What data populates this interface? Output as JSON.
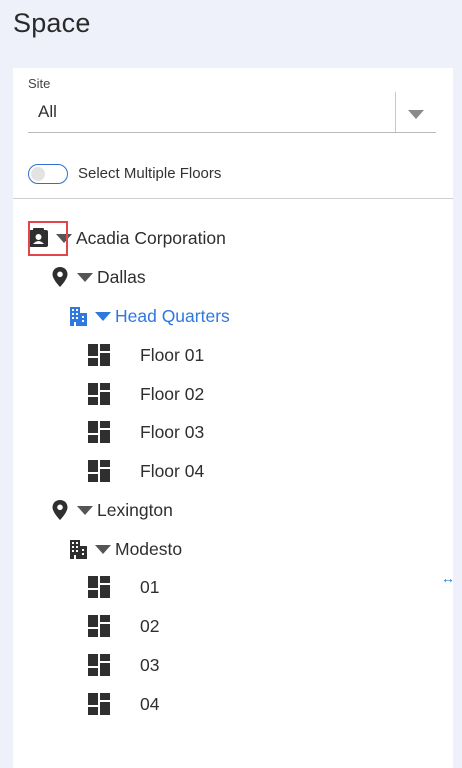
{
  "page_title": "Space",
  "site": {
    "label": "Site",
    "value": "All"
  },
  "toggle": {
    "label": "Select Multiple Floors",
    "on": false
  },
  "tree": {
    "org": {
      "label": "Acadia Corporation",
      "icon": "badge-icon"
    },
    "locations": [
      {
        "label": "Dallas",
        "icon": "map-pin-icon",
        "buildings": [
          {
            "label": "Head Quarters",
            "icon": "building-icon",
            "selected": true,
            "floors": [
              "Floor 01",
              "Floor 02",
              "Floor 03",
              "Floor 04"
            ]
          }
        ]
      },
      {
        "label": "Lexington",
        "icon": "map-pin-icon",
        "buildings": [
          {
            "label": "Modesto",
            "icon": "building-icon",
            "selected": false,
            "floors": [
              "01",
              "02",
              "03",
              "04"
            ]
          }
        ]
      }
    ]
  },
  "colors": {
    "accent": "#2f78e0",
    "highlight": "#e0464b",
    "background": "#eef1f9"
  },
  "resize_handle_glyph": "↔"
}
